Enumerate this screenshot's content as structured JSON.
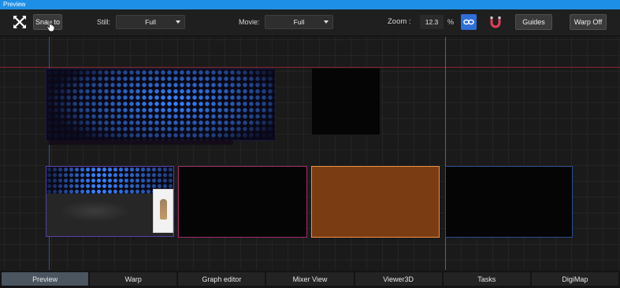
{
  "window": {
    "title": "Preview"
  },
  "toolbar": {
    "snap_label": "Snap to",
    "still_label": "Still:",
    "still_value": "Full",
    "movie_label": "Movie:",
    "movie_value": "Full",
    "zoom_label": "Zoom :",
    "zoom_value": "12.3",
    "zoom_unit": "%",
    "guides_label": "Guides",
    "warp_label": "Warp Off"
  },
  "colors": {
    "accent": "#1e8fe6",
    "orange_screen": "#7a3c13",
    "link_button": "#2f6fd6",
    "magnet": "#e0405a"
  },
  "icons": [
    "fit-screen-icon",
    "link-icon",
    "magnet-icon",
    "chevron-down-icon",
    "hand-cursor-icon"
  ],
  "tabs": [
    {
      "label": "Preview",
      "active": true
    },
    {
      "label": "Warp",
      "active": false
    },
    {
      "label": "Graph editor",
      "active": false
    },
    {
      "label": "Mixer View",
      "active": false
    },
    {
      "label": "Viewer3D",
      "active": false
    },
    {
      "label": "Tasks",
      "active": false
    },
    {
      "label": "DigiMap",
      "active": false
    }
  ]
}
